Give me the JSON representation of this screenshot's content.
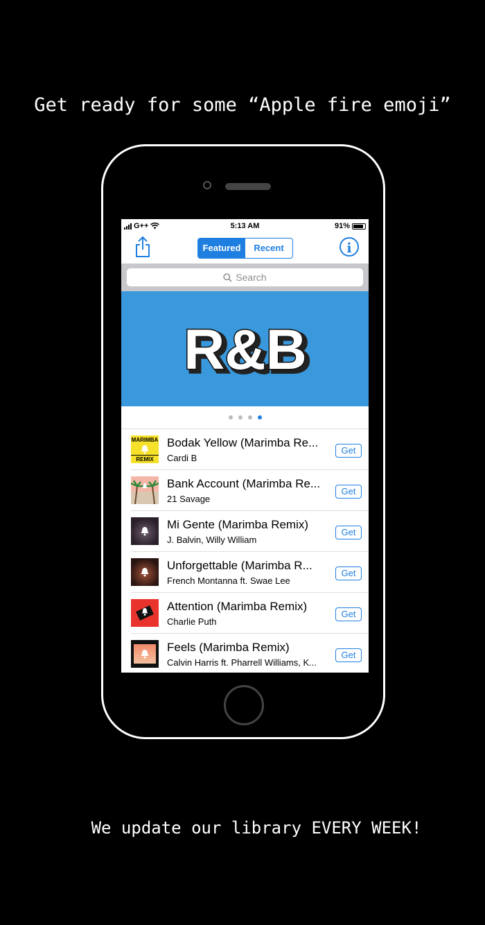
{
  "headline": "Get ready for some “Apple fire emoji”",
  "footer": "We update our library EVERY WEEK!",
  "status": {
    "carrier": "G++",
    "time": "5:13 AM",
    "battery": "91%",
    "battery_level": 0.91
  },
  "navbar": {
    "tabs": [
      "Featured",
      "Recent"
    ],
    "active_tab": "Featured",
    "share_icon": "share-icon",
    "info_icon": "info-icon"
  },
  "search": {
    "placeholder": "Search"
  },
  "banner": {
    "text": "R&B",
    "color": "#3a98dc"
  },
  "pager": {
    "count": 4,
    "active": 4
  },
  "songs": [
    {
      "title": "Bodak Yellow (Marimba Re...",
      "artist": "Cardi B",
      "button": "Get",
      "art_text_top": "MARIMBA",
      "art_text_bottom": "REMIX"
    },
    {
      "title": "Bank Account (Marimba Re...",
      "artist": "21 Savage",
      "button": "Get"
    },
    {
      "title": "Mi Gente (Marimba Remix)",
      "artist": "J. Balvin, Willy William",
      "button": "Get"
    },
    {
      "title": "Unforgettable (Marimba R...",
      "artist": "French Montanna ft. Swae Lee",
      "button": "Get"
    },
    {
      "title": "Attention (Marimba Remix)",
      "artist": "Charlie Puth",
      "button": "Get"
    },
    {
      "title": "Feels (Marimba Remix)",
      "artist": "Calvin Harris ft. Pharrell Williams, K...",
      "button": "Get"
    }
  ],
  "colors": {
    "accent": "#1f7fe0",
    "background": "#000000"
  }
}
